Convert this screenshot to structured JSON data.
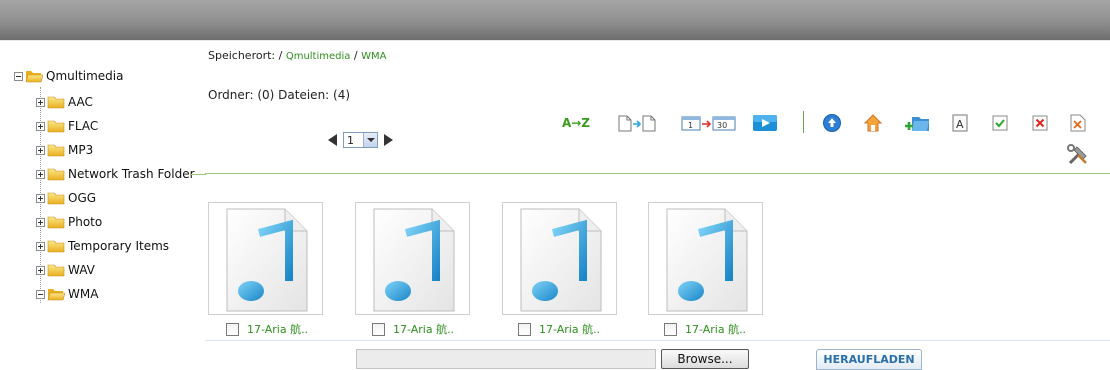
{
  "tree": {
    "root": {
      "label": "Qmultimedia",
      "expanded": true
    },
    "items": [
      {
        "label": "AAC",
        "expanded": false
      },
      {
        "label": "FLAC",
        "expanded": false
      },
      {
        "label": "MP3",
        "expanded": false
      },
      {
        "label": "Network Trash Folder",
        "expanded": false
      },
      {
        "label": "OGG",
        "expanded": false
      },
      {
        "label": "Photo",
        "expanded": false
      },
      {
        "label": "Temporary Items",
        "expanded": false
      },
      {
        "label": "WAV",
        "expanded": false
      },
      {
        "label": "WMA",
        "expanded": true
      }
    ]
  },
  "breadcrumb": {
    "prefix": "Speicherort: / ",
    "root_link": "Qmultimedia",
    "separator": " / ",
    "current_link": "WMA"
  },
  "status": {
    "folder_count": "Ordner: (0) Dateien: (4)"
  },
  "pager": {
    "current_page": "1"
  },
  "toolbar": {
    "sort_az_label": "A→Z",
    "icons": [
      "sort-az-icon",
      "sort-by-type-icon",
      "sort-by-date-icon",
      "play-icon",
      "upload-arrow-icon",
      "home-icon",
      "new-folder-icon",
      "rename-icon",
      "select-all-icon",
      "deselect-icon",
      "delete-icon",
      "settings-icon"
    ]
  },
  "files": [
    {
      "name": "17-Aria 航..",
      "checked": false
    },
    {
      "name": "17-Aria 航..",
      "checked": false
    },
    {
      "name": "17-Aria 航..",
      "checked": false
    },
    {
      "name": "17-Aria 航..",
      "checked": false
    }
  ],
  "upload": {
    "file_path_value": "",
    "browse_label": "Browse...",
    "upload_label": "HERAUFLADEN"
  },
  "colors": {
    "accent_green": "#2f8f1e",
    "upload_blue": "#2a6fa8",
    "folder_yellow": "#f0c419"
  }
}
